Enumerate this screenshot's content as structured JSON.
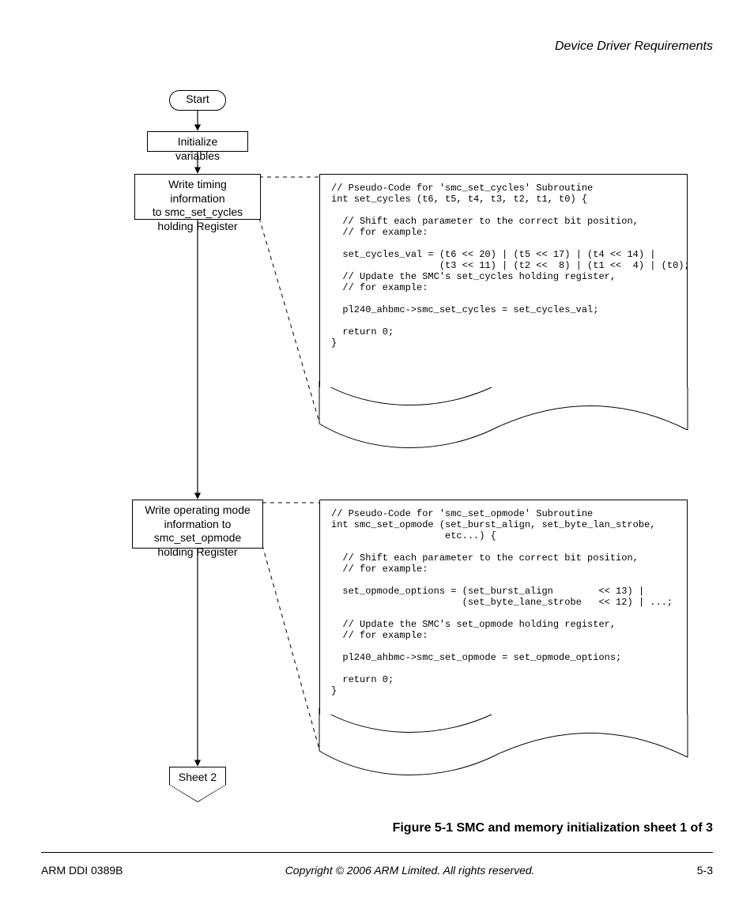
{
  "header": {
    "section_title": "Device Driver Requirements"
  },
  "flow": {
    "start": "Start",
    "init_vars": "Initialize variables",
    "write_timing": "Write timing information\nto smc_set_cycles\nholding Register",
    "write_opmode": "Write operating mode\ninformation to\nsmc_set_opmode\nholding Register",
    "sheet2": "Sheet 2"
  },
  "code": {
    "set_cycles": "// Pseudo-Code for 'smc_set_cycles' Subroutine\nint set_cycles (t6, t5, t4, t3, t2, t1, t0) {\n\n  // Shift each parameter to the correct bit position,\n  // for example:\n\n  set_cycles_val = (t6 << 20) | (t5 << 17) | (t4 << 14) |\n                   (t3 << 11) | (t2 <<  8) | (t1 <<  4) | (t0);\n  // Update the SMC's set_cycles holding register,\n  // for example:\n\n  pl240_ahbmc->smc_set_cycles = set_cycles_val;\n\n  return 0;\n}",
    "set_opmode": "// Pseudo-Code for 'smc_set_opmode' Subroutine\nint smc_set_opmode (set_burst_align, set_byte_lan_strobe,\n                    etc...) {\n\n  // Shift each parameter to the correct bit position,\n  // for example:\n\n  set_opmode_options = (set_burst_align        << 13) |\n                       (set_byte_lane_strobe   << 12) | ...;\n\n  // Update the SMC's set_opmode holding register,\n  // for example:\n\n  pl240_ahbmc->smc_set_opmode = set_opmode_options;\n\n  return 0;\n}"
  },
  "caption": "Figure 5-1 SMC and memory initialization sheet 1 of 3",
  "footer": {
    "left": "ARM DDI 0389B",
    "center": "Copyright © 2006 ARM Limited. All rights reserved.",
    "right": "5-3"
  }
}
